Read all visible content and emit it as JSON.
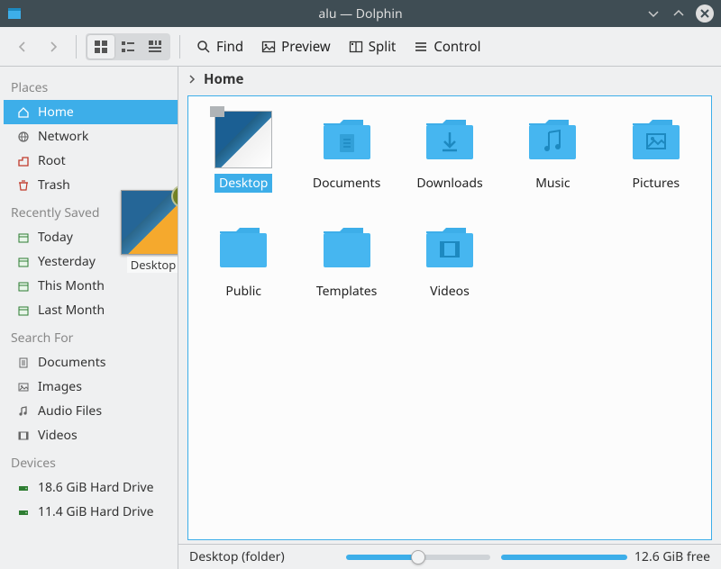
{
  "window": {
    "title": "alu — Dolphin"
  },
  "toolbar": {
    "find": "Find",
    "preview": "Preview",
    "split": "Split",
    "control": "Control"
  },
  "breadcrumb": {
    "home": "Home"
  },
  "sidebar": {
    "sections": [
      {
        "header": "Places",
        "items": [
          {
            "icon": "home-icon",
            "label": "Home",
            "selected": true
          },
          {
            "icon": "network-icon",
            "label": "Network"
          },
          {
            "icon": "root-icon",
            "label": "Root"
          },
          {
            "icon": "trash-icon",
            "label": "Trash"
          }
        ]
      },
      {
        "header": "Recently Saved",
        "items": [
          {
            "icon": "calendar-icon",
            "label": "Today"
          },
          {
            "icon": "calendar-icon",
            "label": "Yesterday"
          },
          {
            "icon": "calendar-icon",
            "label": "This Month"
          },
          {
            "icon": "calendar-icon",
            "label": "Last Month"
          }
        ]
      },
      {
        "header": "Search For",
        "items": [
          {
            "icon": "doc-icon",
            "label": "Documents"
          },
          {
            "icon": "image-icon",
            "label": "Images"
          },
          {
            "icon": "audio-icon",
            "label": "Audio Files"
          },
          {
            "icon": "video-icon",
            "label": "Videos"
          }
        ]
      },
      {
        "header": "Devices",
        "items": [
          {
            "icon": "drive-icon",
            "label": "18.6 GiB Hard Drive"
          },
          {
            "icon": "drive-icon",
            "label": "11.4 GiB Hard Drive"
          }
        ]
      }
    ]
  },
  "drag_ghost": {
    "label": "Desktop"
  },
  "files": [
    {
      "name": "Desktop",
      "kind": "desktop-thumb",
      "glyph": "",
      "selected": true
    },
    {
      "name": "Documents",
      "kind": "folder",
      "glyph": "document"
    },
    {
      "name": "Downloads",
      "kind": "folder",
      "glyph": "download"
    },
    {
      "name": "Music",
      "kind": "folder",
      "glyph": "music"
    },
    {
      "name": "Pictures",
      "kind": "folder",
      "glyph": "picture"
    },
    {
      "name": "Public",
      "kind": "folder",
      "glyph": ""
    },
    {
      "name": "Templates",
      "kind": "folder",
      "glyph": ""
    },
    {
      "name": "Videos",
      "kind": "folder",
      "glyph": "video"
    }
  ],
  "statusbar": {
    "selection": "Desktop (folder)",
    "free_space": "12.6 GiB free"
  },
  "colors": {
    "accent": "#3daee9",
    "titlebar": "#3f4d54"
  }
}
